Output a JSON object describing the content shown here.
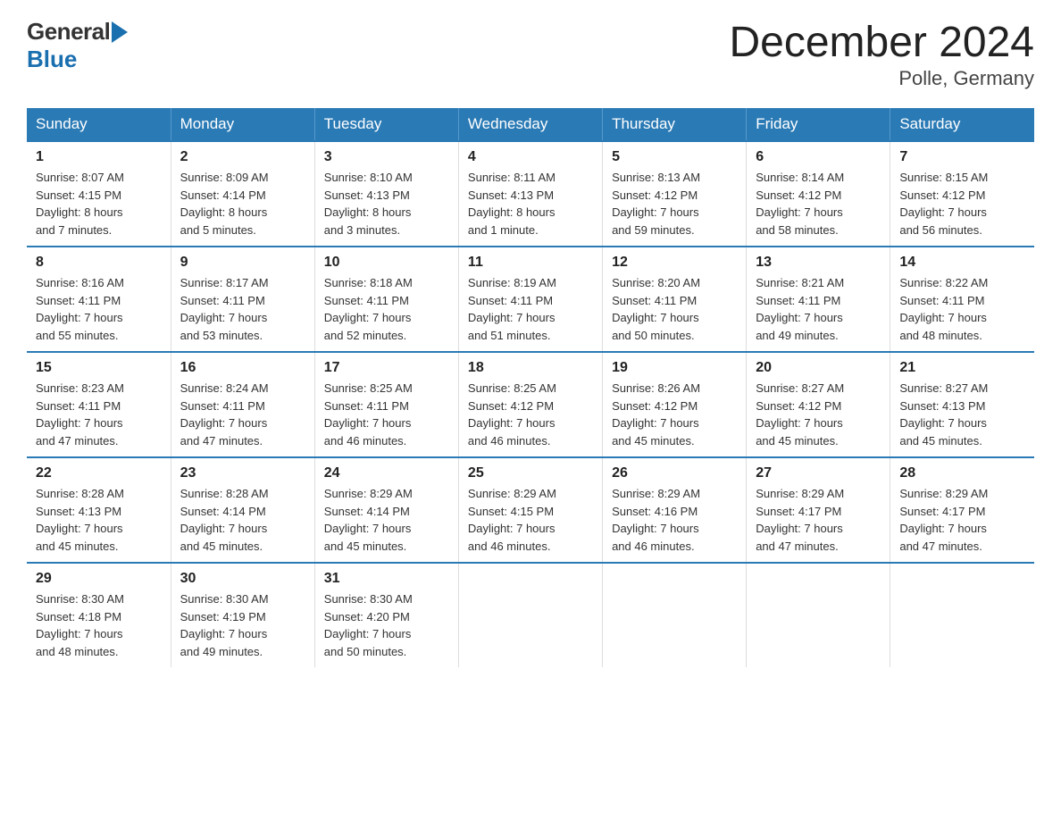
{
  "header": {
    "logo_general": "General",
    "logo_blue": "Blue",
    "month_title": "December 2024",
    "location": "Polle, Germany"
  },
  "days_of_week": [
    "Sunday",
    "Monday",
    "Tuesday",
    "Wednesday",
    "Thursday",
    "Friday",
    "Saturday"
  ],
  "weeks": [
    [
      {
        "day": "1",
        "sunrise": "Sunrise: 8:07 AM",
        "sunset": "Sunset: 4:15 PM",
        "daylight": "Daylight: 8 hours",
        "minutes": "and 7 minutes."
      },
      {
        "day": "2",
        "sunrise": "Sunrise: 8:09 AM",
        "sunset": "Sunset: 4:14 PM",
        "daylight": "Daylight: 8 hours",
        "minutes": "and 5 minutes."
      },
      {
        "day": "3",
        "sunrise": "Sunrise: 8:10 AM",
        "sunset": "Sunset: 4:13 PM",
        "daylight": "Daylight: 8 hours",
        "minutes": "and 3 minutes."
      },
      {
        "day": "4",
        "sunrise": "Sunrise: 8:11 AM",
        "sunset": "Sunset: 4:13 PM",
        "daylight": "Daylight: 8 hours",
        "minutes": "and 1 minute."
      },
      {
        "day": "5",
        "sunrise": "Sunrise: 8:13 AM",
        "sunset": "Sunset: 4:12 PM",
        "daylight": "Daylight: 7 hours",
        "minutes": "and 59 minutes."
      },
      {
        "day": "6",
        "sunrise": "Sunrise: 8:14 AM",
        "sunset": "Sunset: 4:12 PM",
        "daylight": "Daylight: 7 hours",
        "minutes": "and 58 minutes."
      },
      {
        "day": "7",
        "sunrise": "Sunrise: 8:15 AM",
        "sunset": "Sunset: 4:12 PM",
        "daylight": "Daylight: 7 hours",
        "minutes": "and 56 minutes."
      }
    ],
    [
      {
        "day": "8",
        "sunrise": "Sunrise: 8:16 AM",
        "sunset": "Sunset: 4:11 PM",
        "daylight": "Daylight: 7 hours",
        "minutes": "and 55 minutes."
      },
      {
        "day": "9",
        "sunrise": "Sunrise: 8:17 AM",
        "sunset": "Sunset: 4:11 PM",
        "daylight": "Daylight: 7 hours",
        "minutes": "and 53 minutes."
      },
      {
        "day": "10",
        "sunrise": "Sunrise: 8:18 AM",
        "sunset": "Sunset: 4:11 PM",
        "daylight": "Daylight: 7 hours",
        "minutes": "and 52 minutes."
      },
      {
        "day": "11",
        "sunrise": "Sunrise: 8:19 AM",
        "sunset": "Sunset: 4:11 PM",
        "daylight": "Daylight: 7 hours",
        "minutes": "and 51 minutes."
      },
      {
        "day": "12",
        "sunrise": "Sunrise: 8:20 AM",
        "sunset": "Sunset: 4:11 PM",
        "daylight": "Daylight: 7 hours",
        "minutes": "and 50 minutes."
      },
      {
        "day": "13",
        "sunrise": "Sunrise: 8:21 AM",
        "sunset": "Sunset: 4:11 PM",
        "daylight": "Daylight: 7 hours",
        "minutes": "and 49 minutes."
      },
      {
        "day": "14",
        "sunrise": "Sunrise: 8:22 AM",
        "sunset": "Sunset: 4:11 PM",
        "daylight": "Daylight: 7 hours",
        "minutes": "and 48 minutes."
      }
    ],
    [
      {
        "day": "15",
        "sunrise": "Sunrise: 8:23 AM",
        "sunset": "Sunset: 4:11 PM",
        "daylight": "Daylight: 7 hours",
        "minutes": "and 47 minutes."
      },
      {
        "day": "16",
        "sunrise": "Sunrise: 8:24 AM",
        "sunset": "Sunset: 4:11 PM",
        "daylight": "Daylight: 7 hours",
        "minutes": "and 47 minutes."
      },
      {
        "day": "17",
        "sunrise": "Sunrise: 8:25 AM",
        "sunset": "Sunset: 4:11 PM",
        "daylight": "Daylight: 7 hours",
        "minutes": "and 46 minutes."
      },
      {
        "day": "18",
        "sunrise": "Sunrise: 8:25 AM",
        "sunset": "Sunset: 4:12 PM",
        "daylight": "Daylight: 7 hours",
        "minutes": "and 46 minutes."
      },
      {
        "day": "19",
        "sunrise": "Sunrise: 8:26 AM",
        "sunset": "Sunset: 4:12 PM",
        "daylight": "Daylight: 7 hours",
        "minutes": "and 45 minutes."
      },
      {
        "day": "20",
        "sunrise": "Sunrise: 8:27 AM",
        "sunset": "Sunset: 4:12 PM",
        "daylight": "Daylight: 7 hours",
        "minutes": "and 45 minutes."
      },
      {
        "day": "21",
        "sunrise": "Sunrise: 8:27 AM",
        "sunset": "Sunset: 4:13 PM",
        "daylight": "Daylight: 7 hours",
        "minutes": "and 45 minutes."
      }
    ],
    [
      {
        "day": "22",
        "sunrise": "Sunrise: 8:28 AM",
        "sunset": "Sunset: 4:13 PM",
        "daylight": "Daylight: 7 hours",
        "minutes": "and 45 minutes."
      },
      {
        "day": "23",
        "sunrise": "Sunrise: 8:28 AM",
        "sunset": "Sunset: 4:14 PM",
        "daylight": "Daylight: 7 hours",
        "minutes": "and 45 minutes."
      },
      {
        "day": "24",
        "sunrise": "Sunrise: 8:29 AM",
        "sunset": "Sunset: 4:14 PM",
        "daylight": "Daylight: 7 hours",
        "minutes": "and 45 minutes."
      },
      {
        "day": "25",
        "sunrise": "Sunrise: 8:29 AM",
        "sunset": "Sunset: 4:15 PM",
        "daylight": "Daylight: 7 hours",
        "minutes": "and 46 minutes."
      },
      {
        "day": "26",
        "sunrise": "Sunrise: 8:29 AM",
        "sunset": "Sunset: 4:16 PM",
        "daylight": "Daylight: 7 hours",
        "minutes": "and 46 minutes."
      },
      {
        "day": "27",
        "sunrise": "Sunrise: 8:29 AM",
        "sunset": "Sunset: 4:17 PM",
        "daylight": "Daylight: 7 hours",
        "minutes": "and 47 minutes."
      },
      {
        "day": "28",
        "sunrise": "Sunrise: 8:29 AM",
        "sunset": "Sunset: 4:17 PM",
        "daylight": "Daylight: 7 hours",
        "minutes": "and 47 minutes."
      }
    ],
    [
      {
        "day": "29",
        "sunrise": "Sunrise: 8:30 AM",
        "sunset": "Sunset: 4:18 PM",
        "daylight": "Daylight: 7 hours",
        "minutes": "and 48 minutes."
      },
      {
        "day": "30",
        "sunrise": "Sunrise: 8:30 AM",
        "sunset": "Sunset: 4:19 PM",
        "daylight": "Daylight: 7 hours",
        "minutes": "and 49 minutes."
      },
      {
        "day": "31",
        "sunrise": "Sunrise: 8:30 AM",
        "sunset": "Sunset: 4:20 PM",
        "daylight": "Daylight: 7 hours",
        "minutes": "and 50 minutes."
      },
      null,
      null,
      null,
      null
    ]
  ]
}
